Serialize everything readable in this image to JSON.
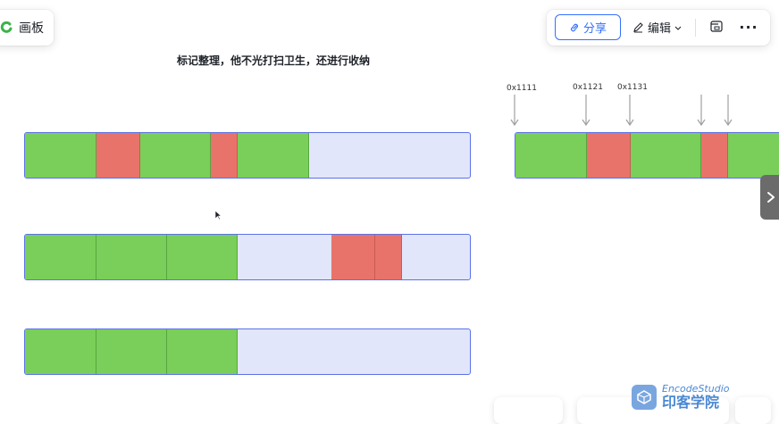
{
  "header": {
    "board_label": "画板"
  },
  "toolbar": {
    "share_label": "分享",
    "edit_label": "编辑"
  },
  "canvas": {
    "heading": "标记整理，他不光打扫卫生，还进行收纳",
    "addresses": [
      "0x1111",
      "0x1121",
      "0x1131"
    ]
  },
  "watermark": {
    "brand_en": "EncodeStudio",
    "brand_cn": "印客学院"
  },
  "colors": {
    "live": "#79cf59",
    "garbage": "#e8736b",
    "free": "#e1e6fb",
    "border": "#5b72e8",
    "accent": "#3370ff"
  },
  "icons": [
    "logo-icon",
    "link-icon",
    "pencil-icon",
    "chevron-down-icon",
    "present-icon",
    "more-icon",
    "chevron-right-icon",
    "mouse-cursor-icon"
  ]
}
